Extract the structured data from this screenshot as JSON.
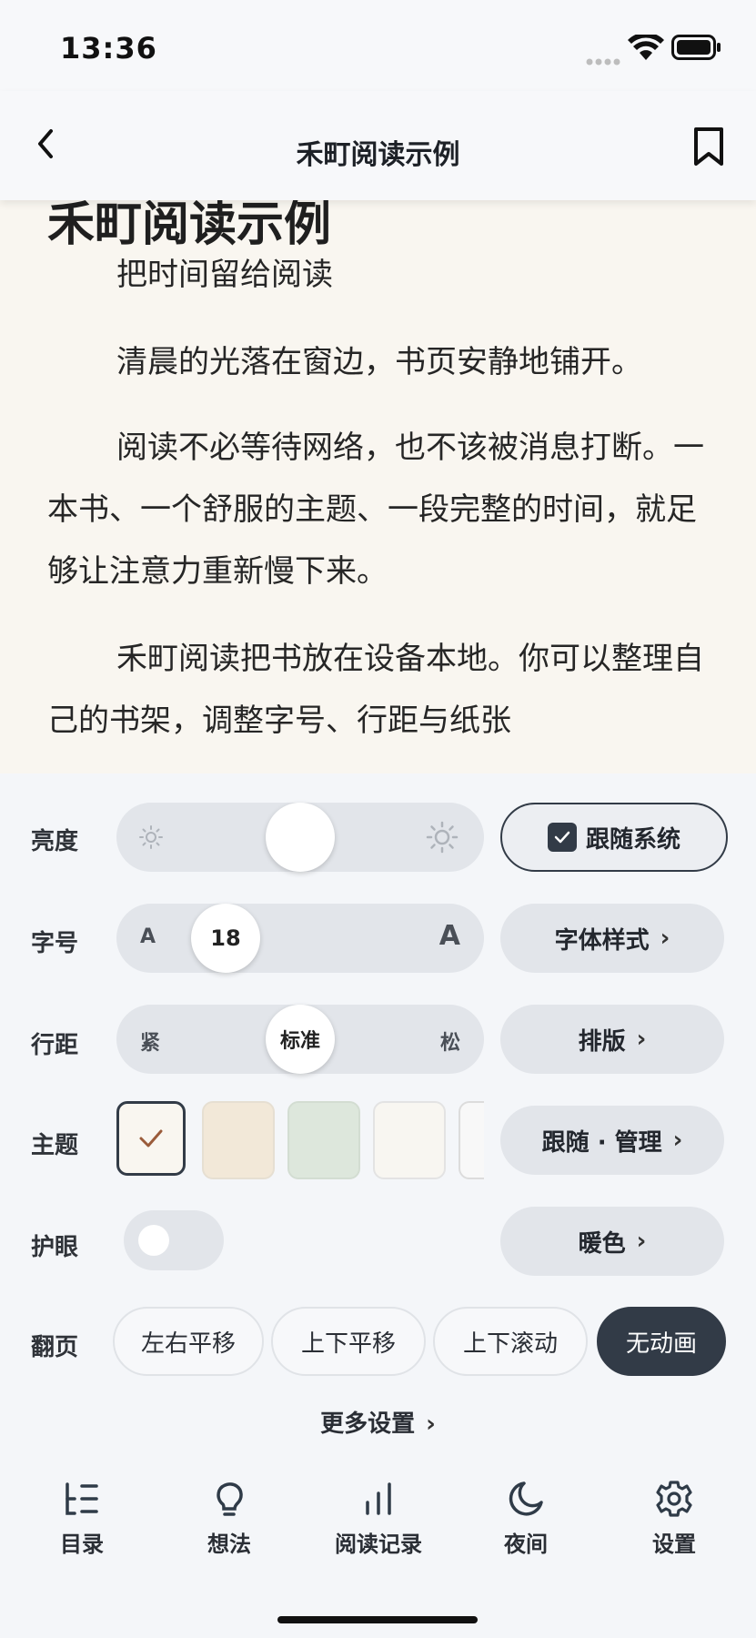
{
  "status": {
    "time": "13:36"
  },
  "header": {
    "title": "禾町阅读示例"
  },
  "book": {
    "heading": "禾町阅读示例",
    "paragraphs": [
      "把时间留给阅读",
      "清晨的光落在窗边，书页安静地铺开。",
      "阅读不必等待网络，也不该被消息打断。一本书、一个舒服的主题、一段完整的时间，就足够让注意力重新慢下来。",
      "禾町阅读把书放在设备本地。你可以整理自己的书架，调整字号、行距与纸张"
    ]
  },
  "settings": {
    "brightness": {
      "label": "亮度",
      "level": 0.5,
      "follow_label": "跟随系统",
      "follow_checked": true
    },
    "font_size": {
      "label": "字号",
      "value": "18",
      "small": "A",
      "large": "A",
      "style_label": "字体样式"
    },
    "line_spacing": {
      "label": "行距",
      "tight": "紧",
      "current": "标准",
      "loose": "松",
      "layout_label": "排版"
    },
    "theme": {
      "label": "主题",
      "manage_label": "跟随 · 管理",
      "swatches": [
        "#f9f6f0",
        "#f2e8d8",
        "#dde7dc",
        "#f8f6f1"
      ]
    },
    "eye_care": {
      "label": "护眼",
      "enabled": false,
      "warm_label": "暖色"
    },
    "page_turn": {
      "label": "翻页",
      "options": [
        "左右平移",
        "上下平移",
        "上下滚动",
        "无动画"
      ],
      "selected": "无动画"
    },
    "more_label": "更多设置"
  },
  "tabs": [
    {
      "label": "目录",
      "icon": "toc-icon"
    },
    {
      "label": "想法",
      "icon": "lightbulb-icon"
    },
    {
      "label": "阅读记录",
      "icon": "bar-chart-icon"
    },
    {
      "label": "夜间",
      "icon": "moon-icon"
    },
    {
      "label": "设置",
      "icon": "gear-icon"
    }
  ],
  "colors": {
    "accent": "#323b47",
    "page_bg": "#f9f6f0",
    "check": "#9a5b3a"
  }
}
